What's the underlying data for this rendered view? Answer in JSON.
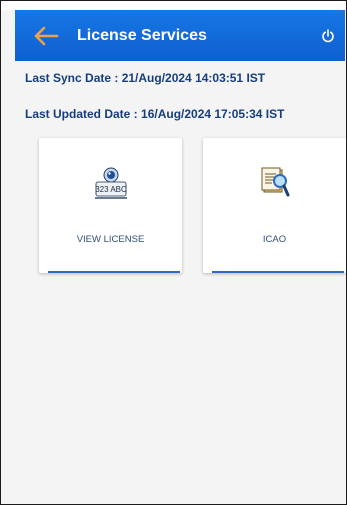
{
  "header": {
    "title": "License Services",
    "back_icon": "arrow-left-icon",
    "power_icon": "power-icon",
    "color_bar": "#1777e5",
    "color_back": "#f0a04b"
  },
  "sync": {
    "last_sync": "Last Sync Date : 21/Aug/2024 14:03:51 IST",
    "last_updated": "Last Updated Date : 16/Aug/2024 17:05:34 IST"
  },
  "cards": [
    {
      "label": "VIEW LICENSE",
      "icon": "license-plate-camera-icon"
    },
    {
      "label": "ICAO",
      "icon": "document-magnifier-icon"
    }
  ],
  "icon_text": "323 ABC"
}
